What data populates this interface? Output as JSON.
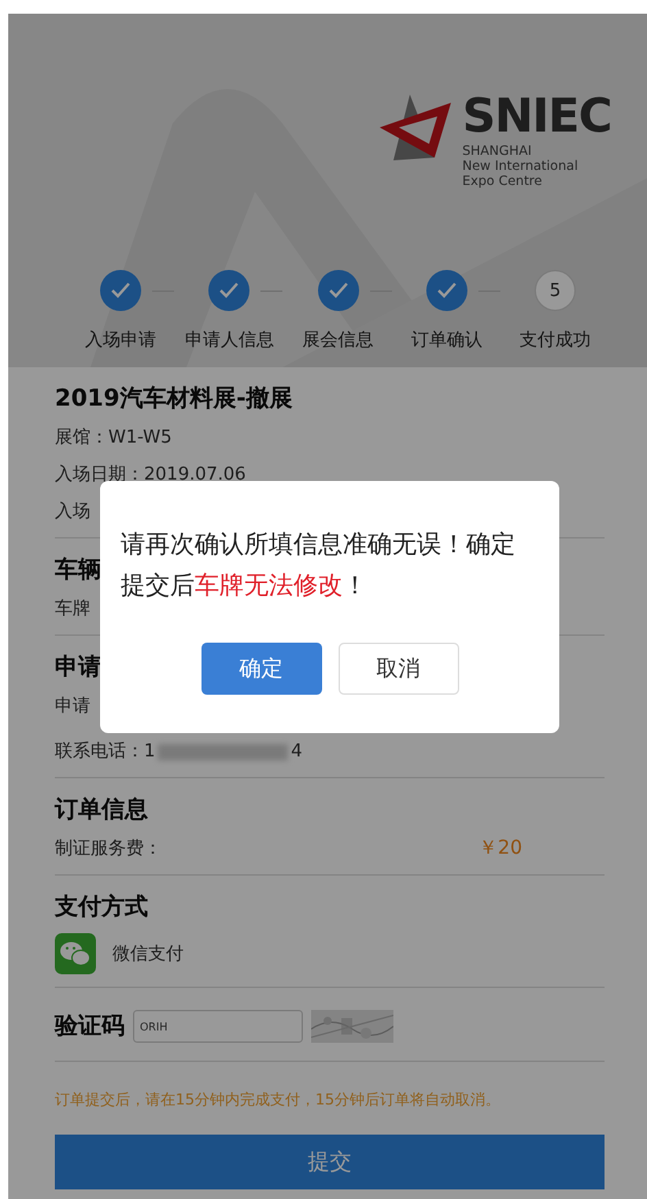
{
  "header": {
    "logo": {
      "name": "SNIEC",
      "subtitle_lines": [
        "SHANGHAI",
        "New International",
        "Expo Centre"
      ]
    }
  },
  "steps": [
    {
      "label": "入场申请",
      "done": true
    },
    {
      "label": "申请人信息",
      "done": true
    },
    {
      "label": "展会信息",
      "done": true
    },
    {
      "label": "订单确认",
      "done": true
    },
    {
      "label": "支付成功",
      "done": false,
      "number": "5"
    }
  ],
  "event": {
    "title": "2019汽车材料展-撤展",
    "lines": [
      "展馆：W1-W5",
      "入场日期：2019.07.06",
      "入场"
    ]
  },
  "vehicle": {
    "heading": "车辆",
    "lines": [
      "车牌"
    ]
  },
  "applicant": {
    "heading": "申请",
    "lines": [
      "申请"
    ],
    "phone": {
      "label": "联系电话：",
      "start": "1",
      "end": "4"
    }
  },
  "order": {
    "heading": "订单信息",
    "fee_label": "制证服务费：",
    "fee": "￥20"
  },
  "payment": {
    "heading": "支付方式",
    "method": "微信支付"
  },
  "captcha": {
    "label": "验证码",
    "value": "ORIH"
  },
  "notice": "订单提交后，请在15分钟内完成支付，15分钟后订单将自动取消。",
  "submit": "提交",
  "dialog": {
    "message_parts": [
      {
        "text": "请再次确认所填信息准确无误！确定提交后",
        "highlight": false
      },
      {
        "text": "车牌无法修改",
        "highlight": true
      },
      {
        "text": "！",
        "highlight": false
      }
    ],
    "buttons": [
      {
        "label": "确定",
        "primary": true
      },
      {
        "label": "取消",
        "primary": false
      }
    ]
  }
}
